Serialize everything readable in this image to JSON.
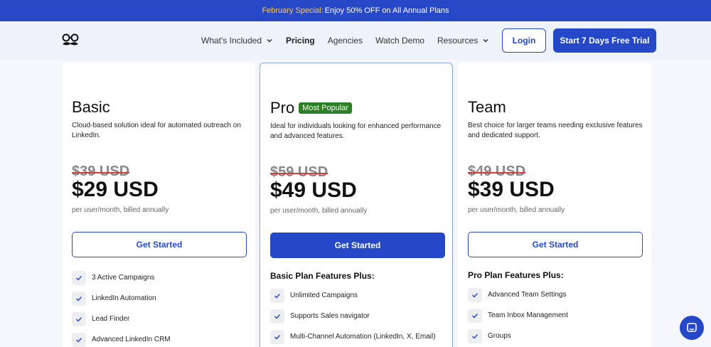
{
  "banner": {
    "highlight": "February Special:",
    "text": "Enjoy 50% OFF on All Annual Plans"
  },
  "nav": {
    "items": [
      {
        "label": "What's Included",
        "has_dropdown": true
      },
      {
        "label": "Pricing",
        "active": true
      },
      {
        "label": "Agencies"
      },
      {
        "label": "Watch Demo"
      },
      {
        "label": "Resources",
        "has_dropdown": true
      }
    ],
    "login_label": "Login",
    "trial_label": "Start 7 Days Free Trial"
  },
  "plans": [
    {
      "name": "Basic",
      "badge": "",
      "description": "Cloud-based solution ideal for automated outreach on LinkedIn.",
      "old_price": "$39 USD",
      "price": "$29 USD",
      "billing": "per user/month, billed annually",
      "cta": "Get Started",
      "features_heading": "",
      "features": [
        "3 Active Campaigns",
        "LinkedIn Automation",
        "Lead Finder",
        "Advanced LinkedIn CRM"
      ]
    },
    {
      "name": "Pro",
      "badge": "Most Popular",
      "description": "Ideal for individuals looking for enhanced performance and advanced features.",
      "old_price": "$59 USD",
      "price": "$49 USD",
      "billing": "per user/month, billed annually",
      "cta": "Get Started",
      "features_heading": "Basic Plan Features Plus:",
      "features": [
        "Unlimited Campaigns",
        "Supports Sales navigator",
        "Multi-Channel Automation (LinkedIn, X, Email)"
      ]
    },
    {
      "name": "Team",
      "badge": "",
      "description": "Best choice for larger teams needing exclusive features and dedicated support.",
      "old_price": "$49 USD",
      "price": "$39 USD",
      "billing": "per user/month, billed annually",
      "cta": "Get Started",
      "features_heading": "Pro Plan Features Plus:",
      "features": [
        "Advanced Team Settings",
        "Team Inbox Management",
        "Groups"
      ]
    }
  ],
  "colors": {
    "primary": "#2548c9",
    "banner": "#2748c7",
    "badge": "#2d7f25",
    "strike": "#d43b3b"
  }
}
